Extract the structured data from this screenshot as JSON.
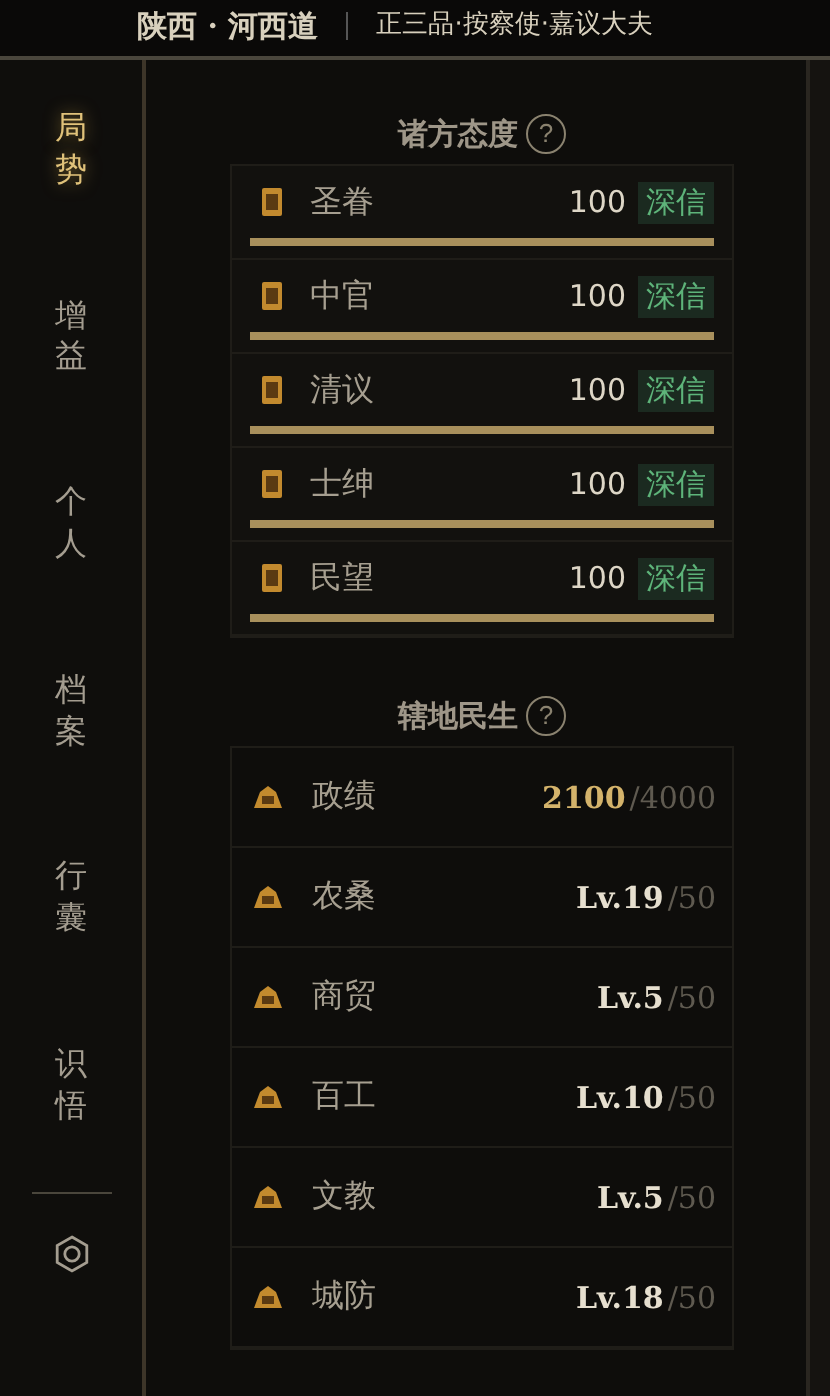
{
  "header": {
    "region": "陕西 · 河西道",
    "rank": "正三品·按察使·嘉议大夫"
  },
  "sidebar": {
    "items": [
      {
        "label": "局势",
        "selected": true
      },
      {
        "label": "增益",
        "selected": false
      },
      {
        "label": "个人",
        "selected": false
      },
      {
        "label": "档案",
        "selected": false
      },
      {
        "label": "行囊",
        "selected": false
      },
      {
        "label": "识悟",
        "selected": false
      }
    ]
  },
  "attitudes": {
    "title": "诸方态度",
    "help": "?",
    "rows": [
      {
        "name": "圣眷",
        "value": "100",
        "status": "深信",
        "level": 1
      },
      {
        "name": "中官",
        "value": "100",
        "status": "深信",
        "level": 1
      },
      {
        "name": "清议",
        "value": "100",
        "status": "深信",
        "level": 1
      },
      {
        "name": "士绅",
        "value": "100",
        "status": "深信",
        "level": 1
      },
      {
        "name": "民望",
        "value": "100",
        "status": "深信",
        "level": 1
      }
    ]
  },
  "livelihood": {
    "title": "辖地民生",
    "help": "?",
    "rows": [
      {
        "name": "政绩",
        "value": "2100",
        "max": "/4000",
        "kind": "score"
      },
      {
        "name": "农桑",
        "value": "Lv.19",
        "max": "/50",
        "kind": "level"
      },
      {
        "name": "商贸",
        "value": "Lv.5",
        "max": "/50",
        "kind": "level"
      },
      {
        "name": "百工",
        "value": "Lv.10",
        "max": "/50",
        "kind": "level"
      },
      {
        "name": "文教",
        "value": "Lv.5",
        "max": "/50",
        "kind": "level"
      },
      {
        "name": "城防",
        "value": "Lv.18",
        "max": "/50",
        "kind": "level"
      }
    ]
  }
}
